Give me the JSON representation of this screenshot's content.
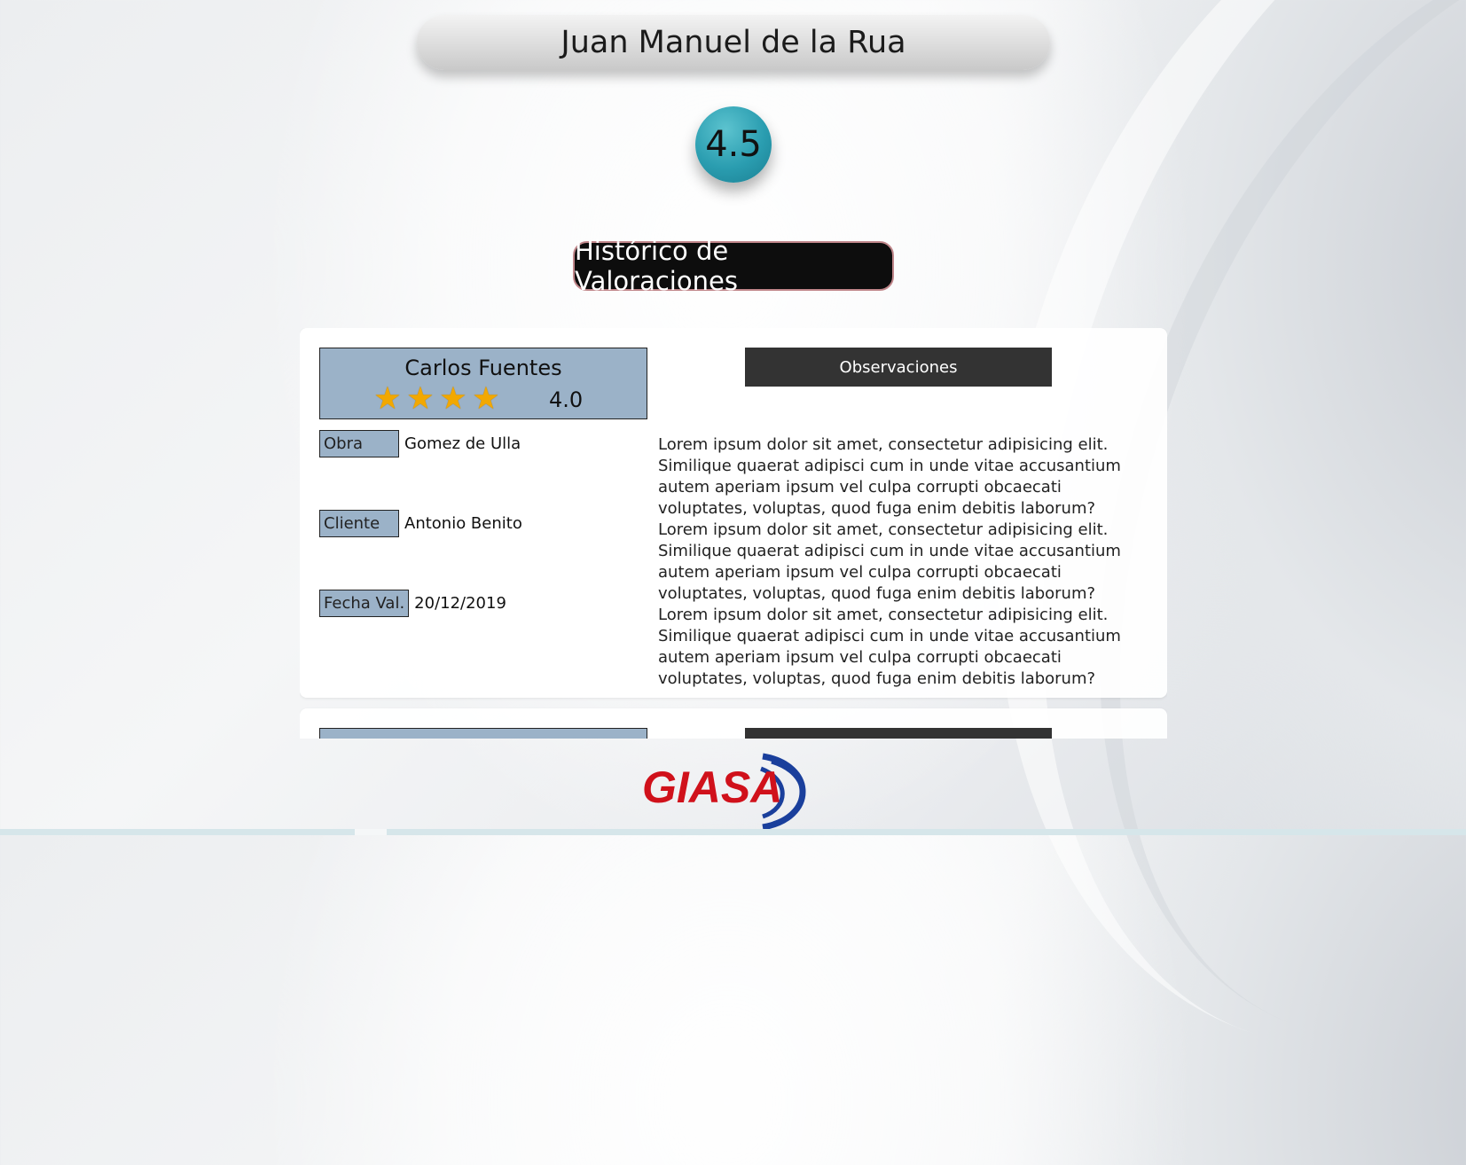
{
  "header": {
    "name": "Juan Manuel de la Rua"
  },
  "overall_rating": "4.5",
  "history_title": "Histórico de Valoraciones",
  "reviews": [
    {
      "reviewer": "Carlos Fuentes",
      "stars": 4,
      "score": "4.0",
      "fields": [
        {
          "label": "Obra",
          "value": "Gomez de Ulla"
        },
        {
          "label": "Cliente",
          "value": "Antonio Benito"
        },
        {
          "label": "Fecha Val.",
          "value": "20/12/2019"
        }
      ],
      "obs_header": "Observaciones",
      "obs_text": "Lorem ipsum dolor sit amet, consectetur adipisicing elit. Similique quaerat adipisci cum in unde vitae accusantium autem aperiam ipsum vel culpa corrupti obcaecati voluptates, voluptas, quod fuga enim debitis laborum?Lorem ipsum dolor sit amet, consectetur adipisicing elit. Similique quaerat adipisci cum in unde vitae accusantium autem aperiam ipsum vel culpa corrupti obcaecati voluptates, voluptas, quod fuga enim debitis laborum? Lorem ipsum dolor sit amet, consectetur adipisicing elit. Similique quaerat adipisci cum in unde vitae accusantium autem aperiam ipsum vel culpa corrupti obcaecati voluptates, voluptas, quod fuga enim debitis laborum?"
    }
  ],
  "logo": {
    "text": "GIASA",
    "text_color": "#d0111b",
    "arc_color": "#1a3f9c"
  },
  "icons": {
    "star": "star-icon"
  }
}
